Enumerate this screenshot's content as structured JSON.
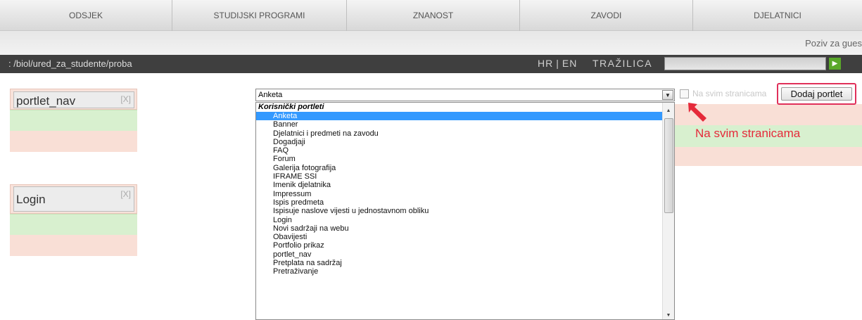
{
  "topnav": {
    "items": [
      "ODSJEK",
      "STUDIJSKI PROGRAMI",
      "ZNANOST",
      "ZAVODI",
      "DJELATNICI"
    ]
  },
  "invite": "Poziv za gues",
  "breadcrumb": ": /biol/ured_za_studente/proba",
  "lang": {
    "hr": "HR",
    "sep": "|",
    "en": "EN"
  },
  "search": {
    "label": "TRAŽILICA",
    "value": ""
  },
  "portlets": [
    {
      "title": "portlet_nav",
      "close": "[X]"
    },
    {
      "title": "Login",
      "close": "[X]"
    }
  ],
  "select": {
    "value": "Anketa",
    "group": "Korisnički portleti",
    "options": [
      "Anketa",
      "Banner",
      "Djelatnici i predmeti na zavodu",
      "Dogadjaji",
      "FAQ",
      "Forum",
      "Galerija fotografija",
      "IFRAME SSI",
      "Imenik djelatnika",
      "Impressum",
      "Ispis predmeta",
      "Ispisuje naslove vijesti u jednostavnom obliku",
      "Login",
      "Novi sadržaji na webu",
      "Obavijesti",
      "Portfolio prikaz",
      "portlet_nav",
      "Pretplata na sadržaj",
      "Pretraživanje"
    ],
    "selected_index": 0
  },
  "checkbox": {
    "label": "Na svim stranicama",
    "checked": false
  },
  "add_button": "Dodaj portlet",
  "annotation": {
    "text": "Na svim stranicama",
    "color": "#e52a3a"
  },
  "colors": {
    "accent_red": "#e0305a",
    "zone_pink": "#f9dfd6",
    "zone_green": "#d8f0cf",
    "dark_bar": "#3f3f3f",
    "selection": "#3399ff"
  }
}
